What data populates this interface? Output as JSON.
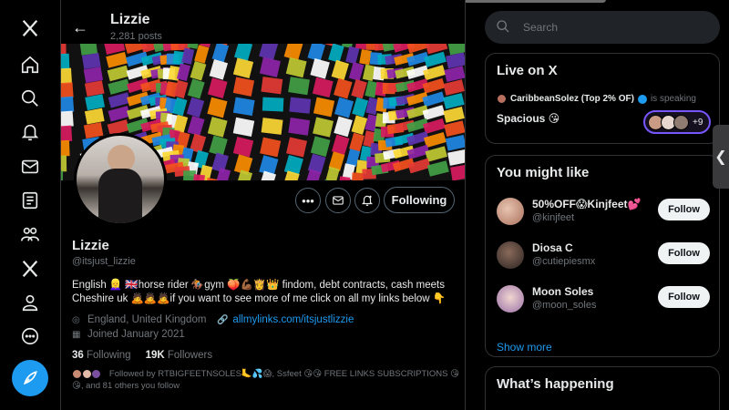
{
  "header": {
    "title": "Lizzie",
    "posts": "2,281 posts"
  },
  "profile": {
    "name": "Lizzie",
    "handle": "@itsjust_lizzie",
    "bio": "English 👱‍♀️ 🇬🇧horse rider 🏇gym 🍑💪🏾👸👑 findom, debt contracts, cash meets Cheshire uk 🙇🙇🙇if you want to see more of me click on all my links below 👇",
    "location": "England, United Kingdom",
    "link": "allmylinks.com/itsjustlizzie",
    "joined": "Joined January 2021",
    "following_count": "36",
    "following_label": "Following",
    "followers_count": "19K",
    "followers_label": "Followers",
    "followed_by": "Followed by RTBIGFEETNSOLES🦶💦😱, Ssfeet 😘😘 FREE LINKS SUBSCRIPTIONS 😘😘, and 81 others you follow",
    "following_button": "Following"
  },
  "search": {
    "placeholder": "Search"
  },
  "live": {
    "title": "Live on X",
    "host": "CaribbeanSolez (Top 2% OF)",
    "status": "is speaking",
    "space_name": "Spacious 😘",
    "extra_listeners": "+9"
  },
  "suggestions": {
    "title": "You might like",
    "items": [
      {
        "name": "50%OFF😱Kinjfeet💕",
        "handle": "@kinjfeet",
        "button": "Follow"
      },
      {
        "name": "Diosa C",
        "handle": "@cutiepiesmx",
        "button": "Follow"
      },
      {
        "name": "Moon Soles",
        "handle": "@moon_soles",
        "button": "Follow"
      }
    ],
    "show_more": "Show more"
  },
  "trending": {
    "title": "What’s happening"
  },
  "icons": [
    "x-logo-icon",
    "home-icon",
    "search-icon",
    "notifications-icon",
    "messages-icon",
    "lists-icon",
    "communities-icon",
    "premium-icon",
    "profile-icon",
    "more-icon",
    "compose-icon",
    "back-arrow-icon",
    "more-options-icon",
    "message-icon",
    "notify-icon",
    "location-icon",
    "link-icon",
    "calendar-icon",
    "verified-icon"
  ],
  "colors": {
    "accent": "#1d9bf0",
    "background": "#000000",
    "border": "#2f3336",
    "muted": "#71767b",
    "space_ring": "#7856ff"
  }
}
